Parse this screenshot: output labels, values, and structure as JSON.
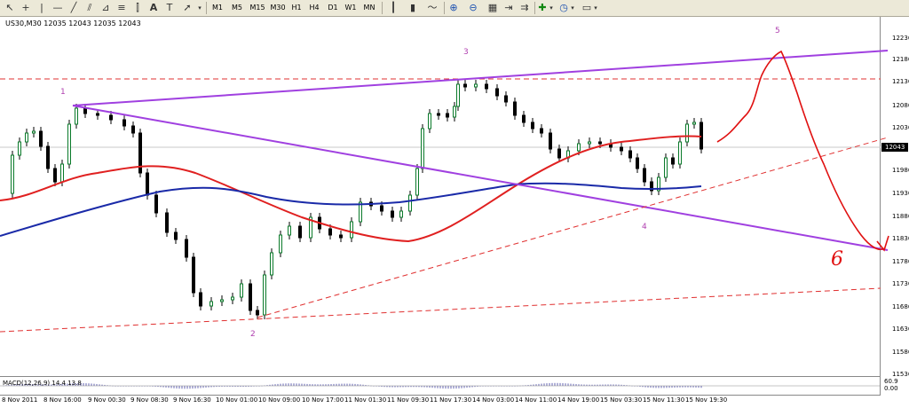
{
  "toolbar": {
    "timeframes": [
      "M1",
      "M5",
      "M15",
      "M30",
      "H1",
      "H4",
      "D1",
      "W1",
      "MN"
    ]
  },
  "chart": {
    "symbol_info": "US30,M30  12035 12043 12035 12043",
    "current_price": "12043",
    "price_scale": [
      "12236",
      "12186",
      "12136",
      "12086",
      "12036",
      "11986",
      "11936",
      "11886",
      "11836",
      "11786",
      "11736",
      "11686",
      "11636",
      "11586",
      "11536"
    ],
    "time_labels": [
      "8 Nov 2011",
      "8 Nov 16:00",
      "9 Nov 00:30",
      "9 Nov 08:30",
      "9 Nov 16:30",
      "10 Nov 01:00",
      "10 Nov 09:00",
      "10 Nov 17:00",
      "11 Nov 01:30",
      "11 Nov 09:30",
      "11 Nov 17:30",
      "14 Nov 03:00",
      "14 Nov 11:00",
      "14 Nov 19:00",
      "15 Nov 03:30",
      "15 Nov 11:30",
      "15 Nov 19:30"
    ],
    "wave_labels": [
      "1",
      "2",
      "3",
      "4",
      "5"
    ],
    "handwritten_label": "6",
    "macd_label": "MACD(12,26,9) 14.4 13.8",
    "macd_scale": [
      "60.9",
      "0.00"
    ]
  },
  "colors": {
    "candle_up": "#0a7a2a",
    "candle_down": "#000000",
    "ma_fast": "#e02020",
    "ma_slow": "#1a2aa8",
    "trendline_purple": "#a040e0",
    "trendline_red_dashed": "#e03030",
    "annotation_red": "#e01010",
    "wave_label": "#b040b0"
  }
}
